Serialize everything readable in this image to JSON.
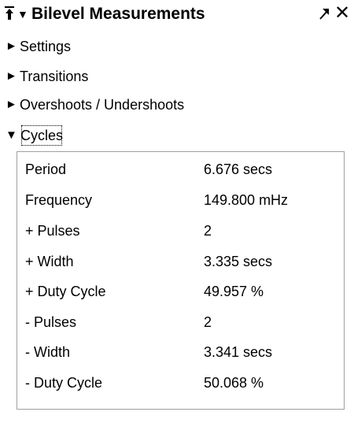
{
  "panel": {
    "title": "Bilevel Measurements",
    "pin_icon": "pin-icon",
    "collapse_icon": "triangle-down-icon",
    "undock_icon": "undock-arrow-icon",
    "close_icon": "close-icon",
    "close_glyph": "✕"
  },
  "sections": [
    {
      "label": "Settings",
      "expanded": false
    },
    {
      "label": "Transitions",
      "expanded": false
    },
    {
      "label": "Overshoots / Undershoots",
      "expanded": false
    },
    {
      "label": "Cycles",
      "expanded": true
    }
  ],
  "cycles": {
    "rows": [
      {
        "name": "Period",
        "value": "6.676 secs"
      },
      {
        "name": "Frequency",
        "value": "149.800 mHz"
      },
      {
        "name": "+ Pulses",
        "value": "2"
      },
      {
        "name": "+ Width",
        "value": "3.335 secs"
      },
      {
        "name": "+ Duty Cycle",
        "value": "49.957 %"
      },
      {
        "name": "- Pulses",
        "value": "2"
      },
      {
        "name": "- Width",
        "value": "3.341 secs"
      },
      {
        "name": "- Duty Cycle",
        "value": "50.068 %"
      }
    ]
  }
}
